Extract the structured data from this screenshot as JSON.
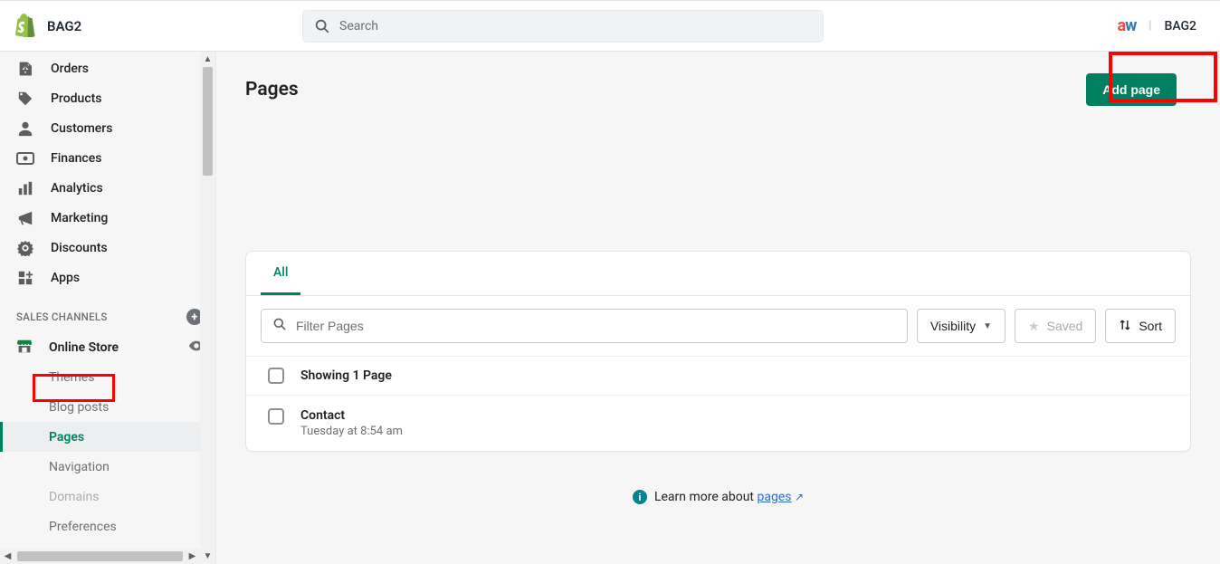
{
  "header": {
    "store_name": "BAG2",
    "search_placeholder": "Search",
    "user_brand_a": "a",
    "user_brand_w": "w",
    "user_label": "BAG2"
  },
  "sidebar": {
    "nav": [
      {
        "name": "orders",
        "label": "Orders"
      },
      {
        "name": "products",
        "label": "Products"
      },
      {
        "name": "customers",
        "label": "Customers"
      },
      {
        "name": "finances",
        "label": "Finances"
      },
      {
        "name": "analytics",
        "label": "Analytics"
      },
      {
        "name": "marketing",
        "label": "Marketing"
      },
      {
        "name": "discounts",
        "label": "Discounts"
      },
      {
        "name": "apps",
        "label": "Apps"
      }
    ],
    "channels_heading": "Sales channels",
    "online_store_label": "Online Store",
    "sub": [
      {
        "name": "themes",
        "label": "Themes"
      },
      {
        "name": "blog-posts",
        "label": "Blog posts"
      },
      {
        "name": "pages",
        "label": "Pages",
        "active": true
      },
      {
        "name": "navigation",
        "label": "Navigation"
      },
      {
        "name": "domains",
        "label": "Domains",
        "disabled": true
      },
      {
        "name": "preferences",
        "label": "Preferences"
      }
    ]
  },
  "main": {
    "title": "Pages",
    "add_button": "Add page",
    "tab_all": "All",
    "filter_placeholder": "Filter Pages",
    "visibility_label": "Visibility",
    "saved_label": "Saved",
    "sort_label": "Sort",
    "showing_text": "Showing 1 Page",
    "rows": [
      {
        "title": "Contact",
        "subtitle": "Tuesday at 8:54 am"
      }
    ],
    "learn_prefix": "Learn more about ",
    "learn_link": "pages"
  }
}
